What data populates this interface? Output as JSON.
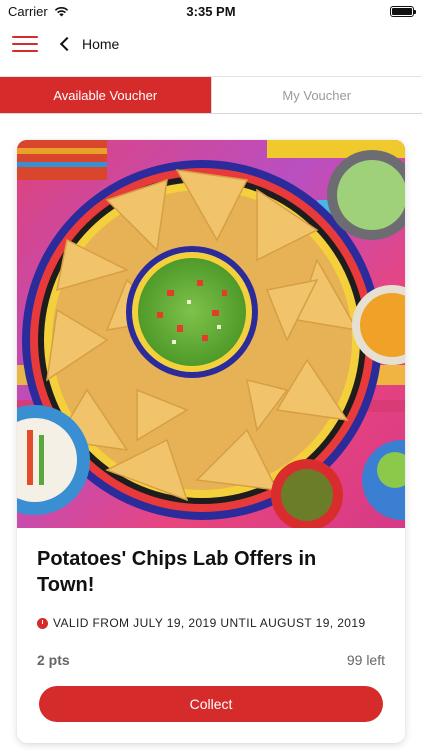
{
  "status_bar": {
    "carrier": "Carrier",
    "time": "3:35 PM"
  },
  "nav": {
    "title": "Home"
  },
  "tabs": [
    {
      "label": "Available Voucher",
      "active": true
    },
    {
      "label": "My Voucher",
      "active": false
    }
  ],
  "voucher": {
    "title": "Potatoes' Chips Lab Offers in Town!",
    "validity": "VALID FROM JULY 19, 2019 UNTIL AUGUST 19, 2019",
    "points": "2 pts",
    "remaining": "99 left",
    "collect_label": "Collect"
  },
  "colors": {
    "accent": "#d62b2b"
  }
}
